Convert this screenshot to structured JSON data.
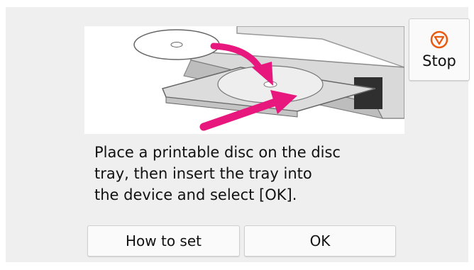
{
  "message": "Place a printable disc on the disc\ntray, then insert the tray into\nthe device and select [OK].",
  "buttons": {
    "how_to_set": "How to set",
    "ok": "OK",
    "stop": "Stop"
  },
  "icons": {
    "stop": "stop-icon"
  },
  "colors": {
    "accent_arrow": "#e8177e",
    "stop_icon": "#e85a10",
    "panel_bg": "#efefef"
  }
}
